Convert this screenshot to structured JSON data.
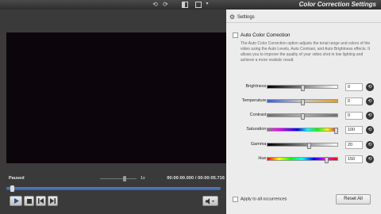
{
  "window": {
    "title": "Color Correction Settings"
  },
  "toolbar": {
    "undo_icon": "undo-icon",
    "redo_icon": "redo-icon",
    "view_icon": "split-view-icon",
    "view_dropdown_icon": "chevron-down-icon"
  },
  "player": {
    "status": "Paused",
    "speed": "1x",
    "timecode": "00:00:00.000 / 00:00:05.716",
    "progress_fraction": 0.02,
    "speed_fraction": 0.7
  },
  "settings": {
    "header": "Settings",
    "auto_correction": {
      "label": "Auto Color Correction",
      "checked": false,
      "description": "The Auto Color Correction option adjusts the tonal range and colors of the video using the Auto Levels, Auto Contrast, and Auto Brightness effects. It allows you to improve the quality of your video shot in low lighting and achieve a more realistic result."
    },
    "adjustments": [
      {
        "label": "Brightness:",
        "value": "0",
        "fraction": 0.5,
        "gradient": "linear-gradient(90deg,#000,#fff)"
      },
      {
        "label": "Temperature:",
        "value": "0",
        "fraction": 0.5,
        "gradient": "linear-gradient(90deg,#3a5ed6,#c8c8c8,#e0a020)"
      },
      {
        "label": "Contrast:",
        "value": "0",
        "fraction": 0.5,
        "gradient": "linear-gradient(90deg,#707070,#b0b0b0,#707070)"
      },
      {
        "label": "Saturation:",
        "value": "100",
        "fraction": 1.0,
        "gradient": "linear-gradient(90deg,#808080,#ff00ff,#8000ff,#0000ff,#00ffff,#00ff00,#ffff00,#ff0000)"
      },
      {
        "label": "Gamma:",
        "value": "20",
        "fraction": 0.6,
        "gradient": "linear-gradient(90deg,#000,#fff)"
      },
      {
        "label": "Hue:",
        "value": "150",
        "fraction": 0.86,
        "gradient": "linear-gradient(90deg,#ff0000,#ffff00,#00ff00,#00ffff,#0000ff,#ff00ff,#ff0000)"
      }
    ],
    "apply_all": {
      "label": "Apply to all occurrences",
      "checked": false
    },
    "reset_all": "Reset All"
  }
}
